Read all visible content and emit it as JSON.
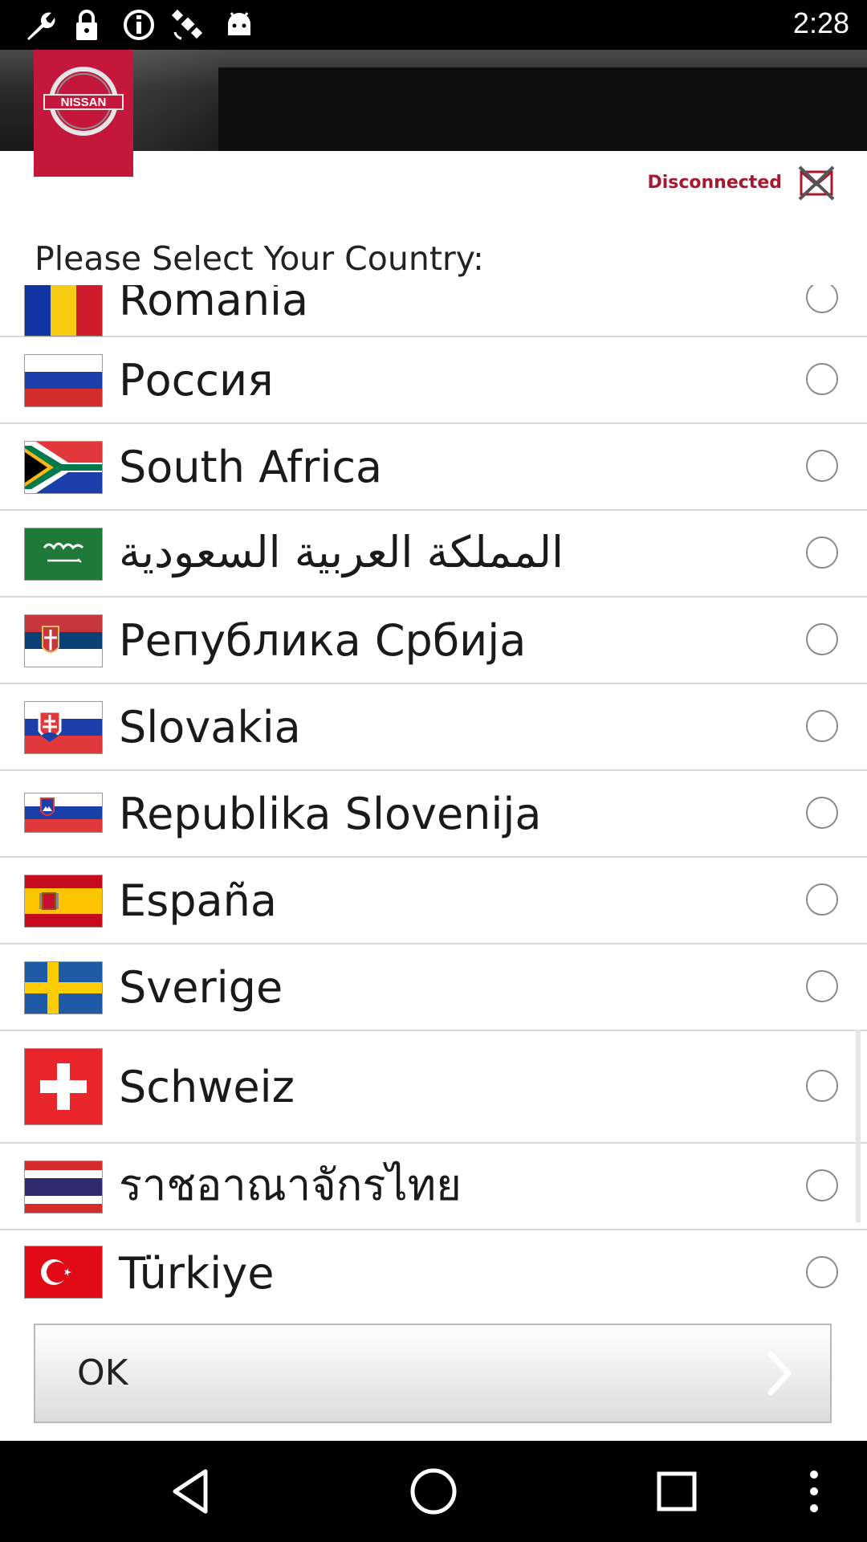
{
  "status_bar": {
    "time": "2:28",
    "icons": [
      "wrench-icon",
      "lock-icon",
      "info-icon",
      "satellite-icon",
      "android-icon"
    ]
  },
  "header": {
    "logo_text": "NISSAN",
    "connection_status": "Disconnected",
    "connection_icon": "disconnected-icon"
  },
  "prompt": "Please Select Your Country:",
  "countries": [
    {
      "name": "Romania",
      "flag": "romania-flag",
      "selected": false
    },
    {
      "name": "Россия",
      "flag": "russia-flag",
      "selected": false
    },
    {
      "name": "South Africa",
      "flag": "south-africa-flag",
      "selected": false
    },
    {
      "name": "المملكة العربية السعودية",
      "flag": "saudi-arabia-flag",
      "selected": false
    },
    {
      "name": "Република Србија",
      "flag": "serbia-flag",
      "selected": false
    },
    {
      "name": "Slovakia",
      "flag": "slovakia-flag",
      "selected": false
    },
    {
      "name": "Republika Slovenija",
      "flag": "slovenia-flag",
      "selected": false
    },
    {
      "name": "España",
      "flag": "spain-flag",
      "selected": false
    },
    {
      "name": "Sverige",
      "flag": "sweden-flag",
      "selected": false
    },
    {
      "name": "Schweiz",
      "flag": "switzerland-flag",
      "selected": false
    },
    {
      "name": "ราชอาณาจักรไทย",
      "flag": "thailand-flag",
      "selected": false
    },
    {
      "name": "Türkiye",
      "flag": "turkey-flag",
      "selected": false
    }
  ],
  "ok_button": {
    "label": "OK",
    "icon": "chevron-right-icon"
  },
  "nav_bar": {
    "icons": [
      "back-icon",
      "home-icon",
      "recents-icon",
      "menu-icon"
    ]
  },
  "colors": {
    "brand": "#c3173b",
    "disconnected": "#a8182f"
  }
}
